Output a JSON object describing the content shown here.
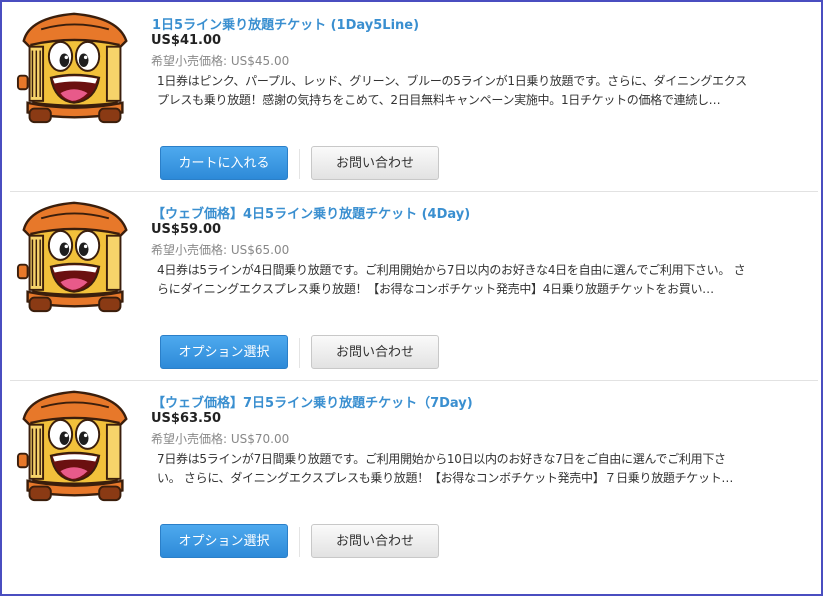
{
  "products": [
    {
      "title": "1日5ライン乗り放題チケット (1Day5Line)",
      "price": "US$41.00",
      "msrp": "希望小売価格: US$45.00",
      "description": "1日券はピンク、パープル、レッド、グリーン、ブルーの5ラインが1日乗り放題です。さらに、ダイニングエクスプレスも乗り放題！感謝の気持ちをこめて、2日目無料キャンペーン実施中。1日チケットの価格で連続し…",
      "primary_button": "カートに入れる",
      "secondary_button": "お問い合わせ"
    },
    {
      "title": "【ウェブ価格】4日5ライン乗り放題チケット (4Day)",
      "price": "US$59.00",
      "msrp": "希望小売価格: US$65.00",
      "description": "4日券は5ラインが4日間乗り放題です。ご利用開始から7日以内のお好きな4日を自由に選んでご利用下さい。 さらにダイニングエクスプレス乗り放題！【お得なコンボチケット発売中】4日乗り放題チケットをお買い…",
      "primary_button": "オプション選択",
      "secondary_button": "お問い合わせ"
    },
    {
      "title": "【ウェブ価格】7日5ライン乗り放題チケット（7Day)",
      "price": "US$63.50",
      "msrp": "希望小売価格: US$70.00",
      "description": "7日券は5ラインが7日間乗り放題です。ご利用開始から10日以内のお好きな7日をご自由に選んでご利用下さい。 さらに、ダイニングエクスプレスも乗り放題！【お得なコンボチケット発売中】７日乗り放題チケット…",
      "primary_button": "オプション選択",
      "secondary_button": "お問い合わせ"
    }
  ],
  "colors": {
    "title": "#3a8fd0",
    "primary_button": "#3a9ae2",
    "frame_border": "#4a4ec0"
  }
}
